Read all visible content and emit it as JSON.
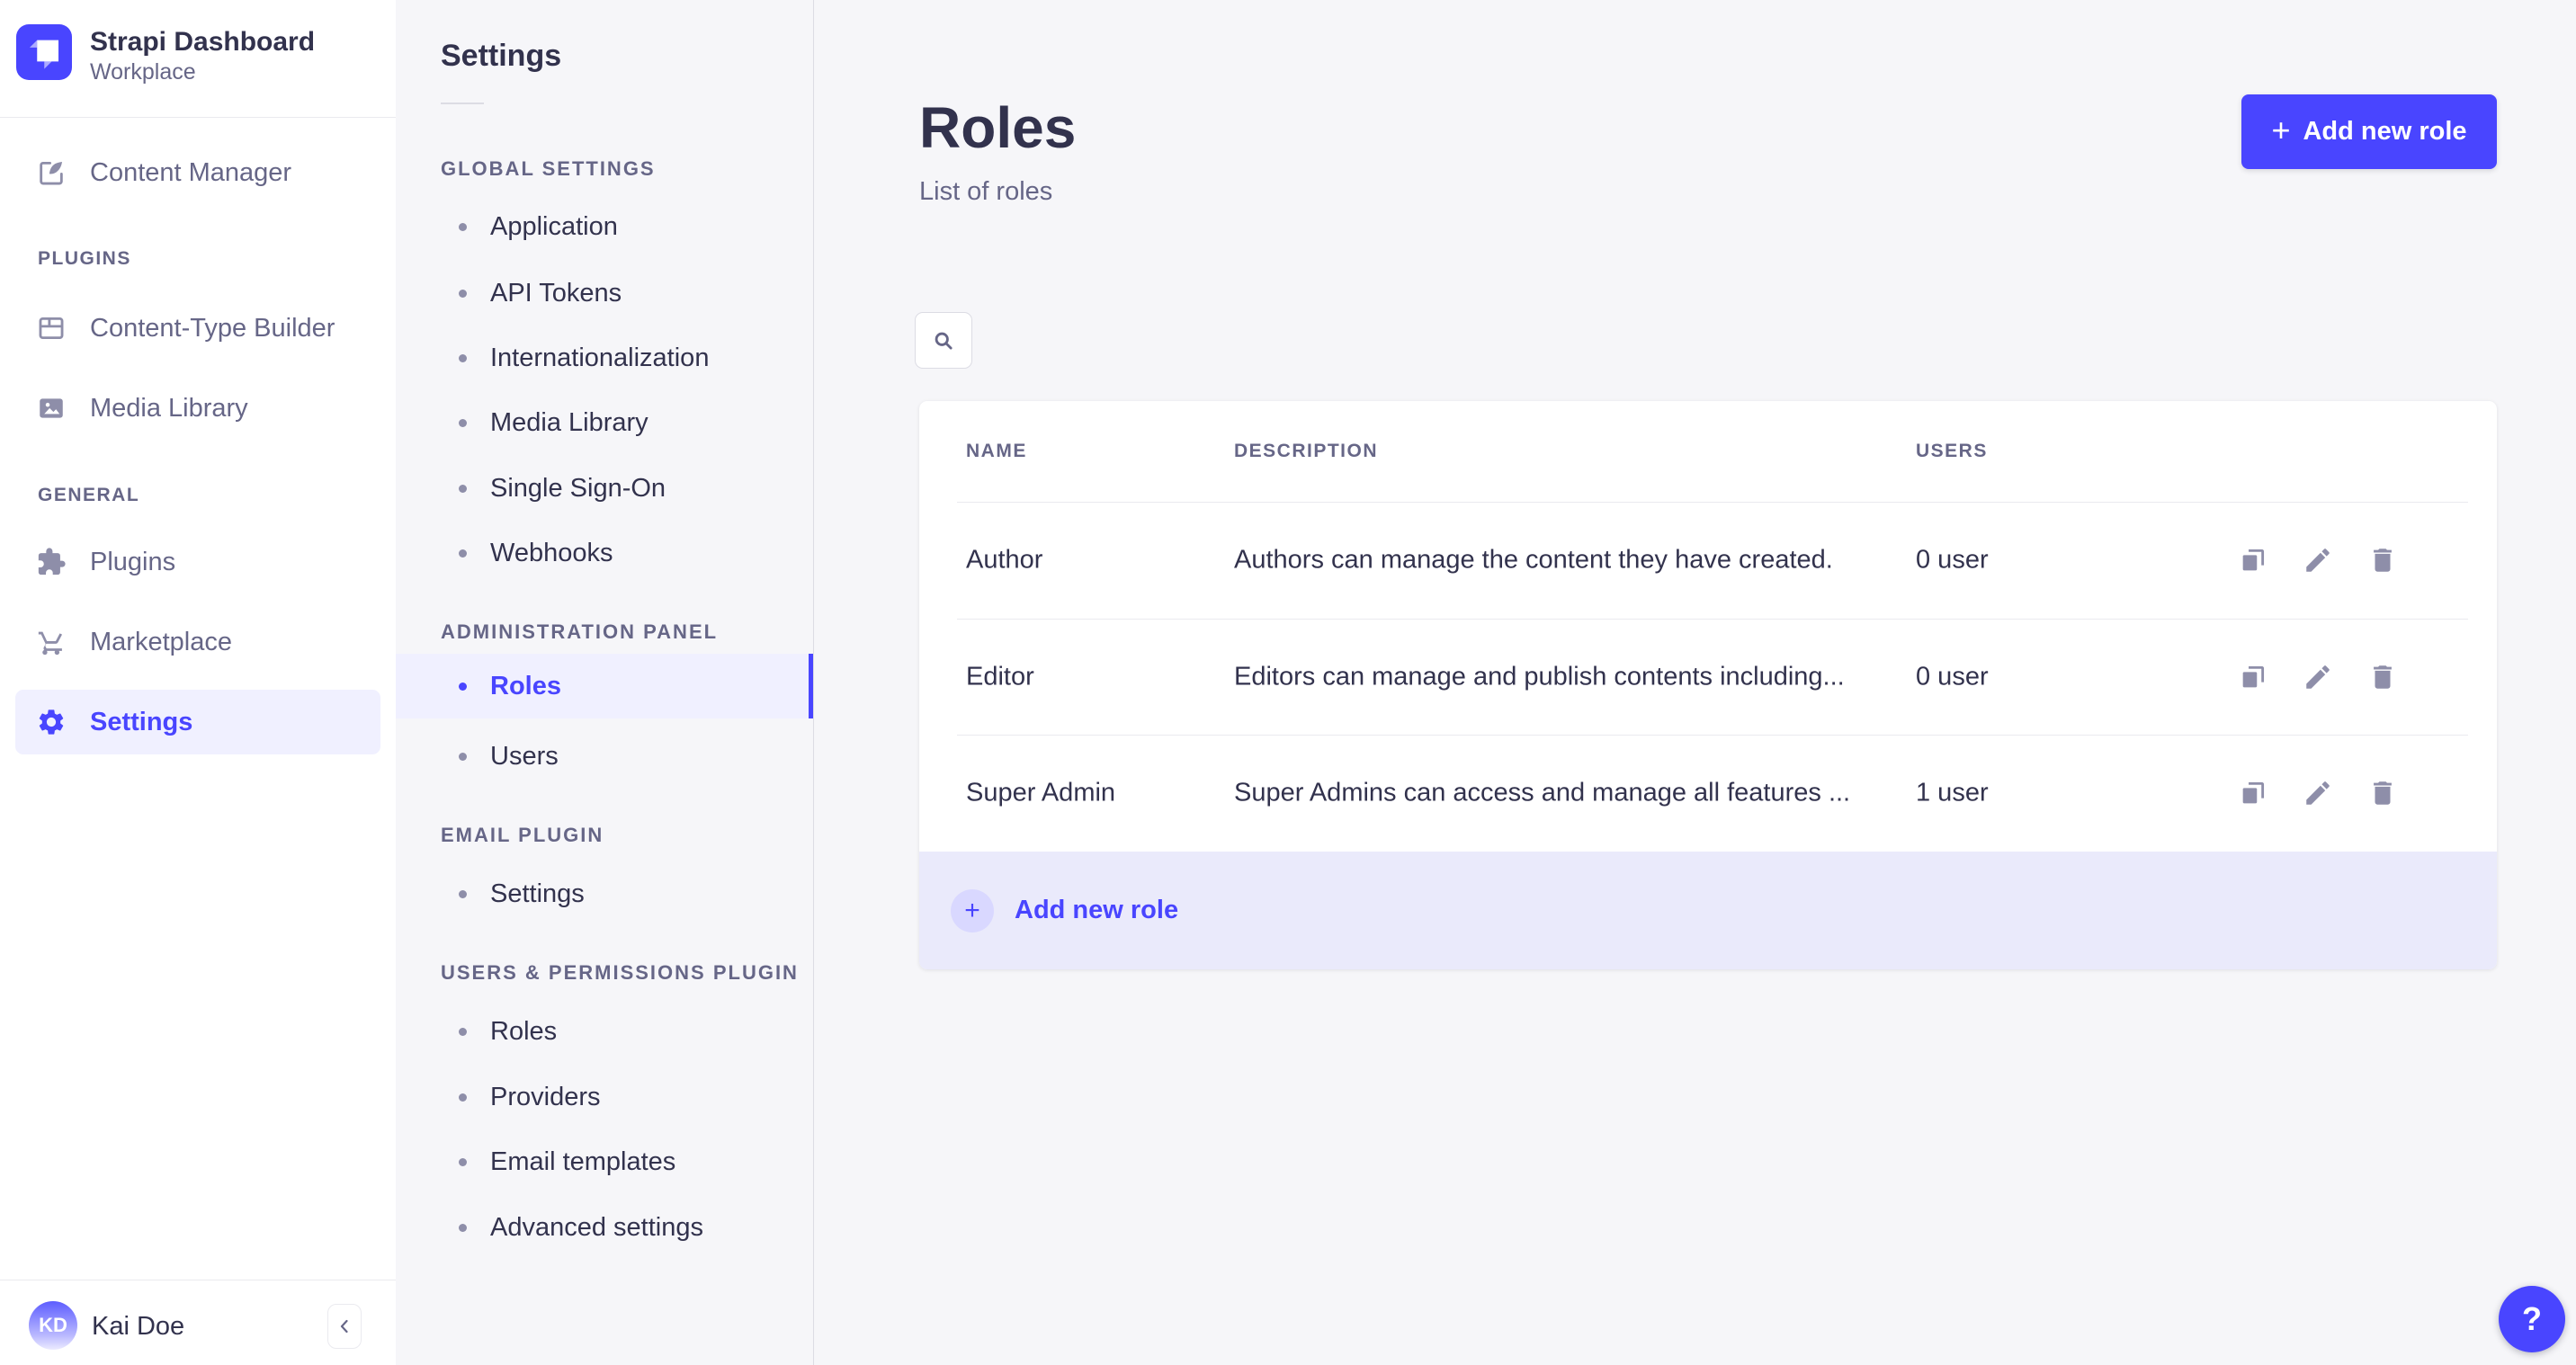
{
  "app": {
    "name": "Strapi Dashboard",
    "workspace": "Workplace"
  },
  "sidebar": {
    "content_manager": "Content Manager",
    "sections": [
      {
        "label": "PLUGINS",
        "items": [
          "Content-Type Builder",
          "Media Library"
        ]
      },
      {
        "label": "GENERAL",
        "items": [
          "Plugins",
          "Marketplace",
          "Settings"
        ]
      }
    ],
    "active_item": "Settings",
    "user": {
      "initials": "KD",
      "name": "Kai Doe"
    }
  },
  "subnav": {
    "title": "Settings",
    "sections": [
      {
        "label": "GLOBAL SETTINGS",
        "items": [
          "Application",
          "API Tokens",
          "Internationalization",
          "Media Library",
          "Single Sign-On",
          "Webhooks"
        ]
      },
      {
        "label": "ADMINISTRATION PANEL",
        "items": [
          "Roles",
          "Users"
        ]
      },
      {
        "label": "EMAIL PLUGIN",
        "items": [
          "Settings"
        ]
      },
      {
        "label": "USERS & PERMISSIONS PLUGIN",
        "items": [
          "Roles",
          "Providers",
          "Email templates",
          "Advanced settings"
        ]
      }
    ],
    "active_item": "Roles"
  },
  "main": {
    "title": "Roles",
    "subtitle": "List of roles",
    "add_button_label": "Add new role",
    "table": {
      "columns": [
        "NAME",
        "DESCRIPTION",
        "USERS"
      ],
      "rows": [
        {
          "name": "Author",
          "description": "Authors can manage the content they have created.",
          "users": "0 user"
        },
        {
          "name": "Editor",
          "description": "Editors can manage and publish contents including...",
          "users": "0 user"
        },
        {
          "name": "Super Admin",
          "description": "Super Admins can access and manage all features ...",
          "users": "1 user"
        }
      ]
    },
    "footer_add_label": "Add new role"
  },
  "icons": {
    "plus": "+",
    "help": "?"
  },
  "colors": {
    "primary": "#4945ff",
    "primary_light_bg": "#f0f0ff",
    "footer_lavender": "#eaeafb",
    "plus_circle_bg": "#d9d8ff",
    "text_dark": "#32324d",
    "text_muted": "#666687",
    "icon_gray": "#8e8ea9",
    "page_bg": "#f6f6f9",
    "border_light": "#eaeaef",
    "border_mid": "#dcdce4"
  }
}
